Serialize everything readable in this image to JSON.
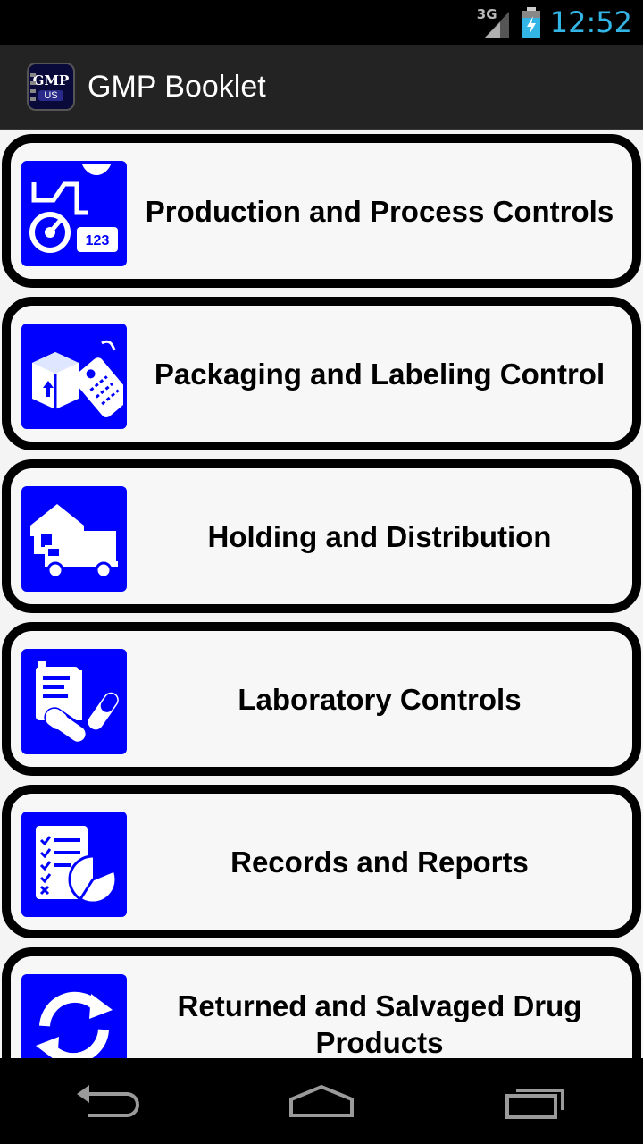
{
  "status_bar": {
    "network": "3G",
    "time": "12:52"
  },
  "action_bar": {
    "title": "GMP Booklet",
    "icon_text_top": "GMP",
    "icon_text_bottom": "US"
  },
  "items": [
    {
      "label": "Production and Process Controls",
      "icon": "gauge-tank-icon",
      "icon_text": "123"
    },
    {
      "label": "Packaging and Labeling Control",
      "icon": "box-tag-icon"
    },
    {
      "label": "Holding and Distribution",
      "icon": "warehouse-truck-icon"
    },
    {
      "label": "Laboratory Controls",
      "icon": "lab-capsule-icon"
    },
    {
      "label": "Records and Reports",
      "icon": "checklist-pie-icon"
    },
    {
      "label": "Returned and Salvaged Drug Products",
      "icon": "recycle-arrows-icon"
    }
  ],
  "colors": {
    "tile": "#0000ff",
    "accent_time": "#33b5e5",
    "card_border": "#000000"
  }
}
